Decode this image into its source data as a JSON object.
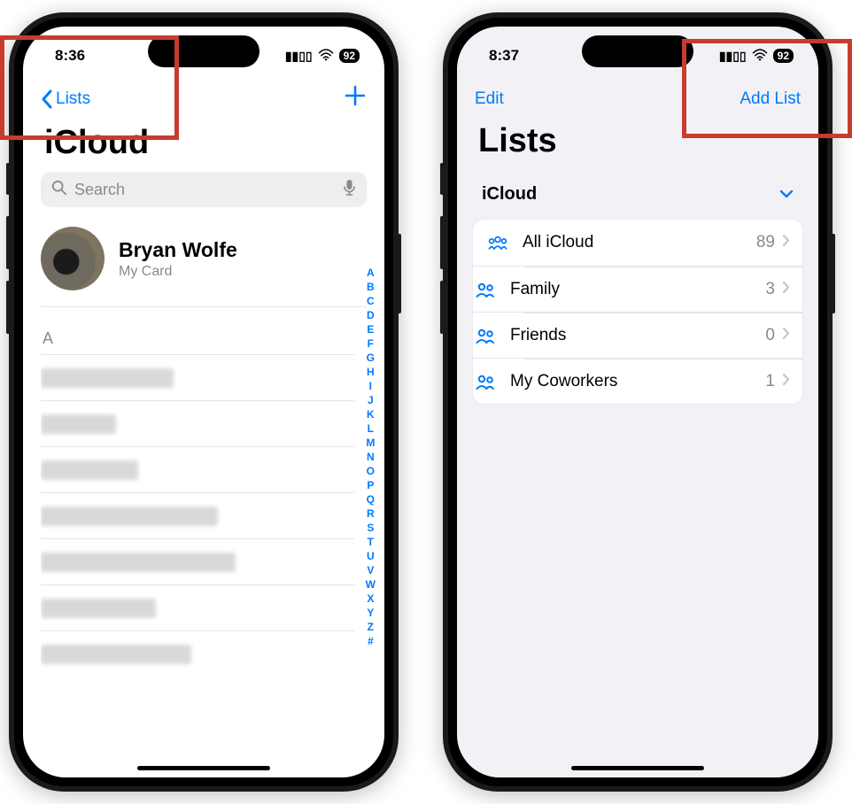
{
  "left": {
    "status": {
      "time": "8:36",
      "battery": "92"
    },
    "nav": {
      "back_label": "Lists",
      "add_label": "+"
    },
    "title": "iCloud",
    "search": {
      "placeholder": "Search"
    },
    "me_card": {
      "name": "Bryan Wolfe",
      "sub": "My Card"
    },
    "index_letters": [
      "A",
      "B",
      "C",
      "D",
      "E",
      "F",
      "G",
      "H",
      "I",
      "J",
      "K",
      "L",
      "M",
      "N",
      "O",
      "P",
      "Q",
      "R",
      "S",
      "T",
      "U",
      "V",
      "W",
      "X",
      "Y",
      "Z",
      "#"
    ],
    "section": "A",
    "blurred_contact_widths": [
      150,
      85,
      110,
      200,
      220,
      130,
      170
    ]
  },
  "right": {
    "status": {
      "time": "8:37",
      "battery": "92"
    },
    "nav": {
      "edit_label": "Edit",
      "add_list_label": "Add List"
    },
    "title": "Lists",
    "group_header": "iCloud",
    "items": [
      {
        "icon": "people3",
        "label": "All iCloud",
        "count": "89"
      },
      {
        "icon": "people2",
        "label": "Family",
        "count": "3"
      },
      {
        "icon": "people2",
        "label": "Friends",
        "count": "0"
      },
      {
        "icon": "people2",
        "label": "My Coworkers",
        "count": "1"
      }
    ]
  }
}
